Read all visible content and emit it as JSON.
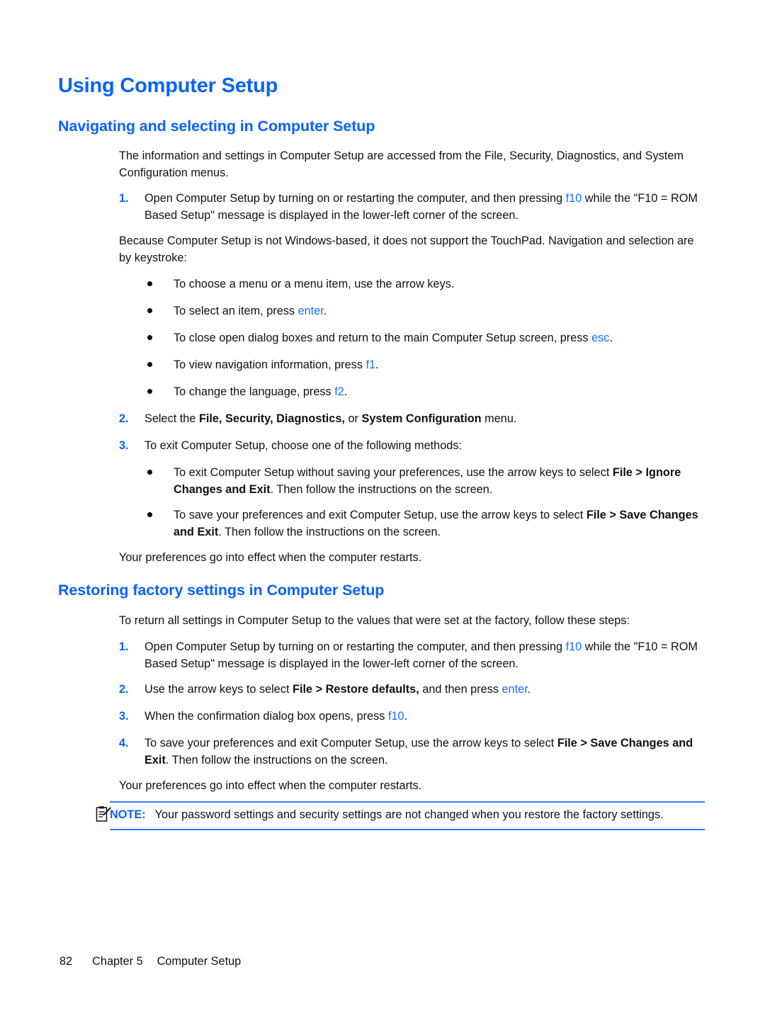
{
  "document": {
    "title": "Using Computer Setup"
  },
  "sections": {
    "navigating": {
      "heading": "Navigating and selecting in Computer Setup",
      "intro": "The information and settings in Computer Setup are accessed from the File, Security, Diagnostics, and System Configuration menus.",
      "step1": {
        "number": "1.",
        "text_a": "Open Computer Setup by turning on or restarting the computer, and then pressing ",
        "key": "f10",
        "text_b": " while the \"F10 = ROM Based Setup\" message is displayed in the lower-left corner of the screen."
      },
      "keystroke_intro": "Because Computer Setup is not Windows-based, it does not support the TouchPad. Navigation and selection are by keystroke:",
      "bullets": [
        {
          "text_a": "To choose a menu or a menu item, use the arrow keys.",
          "key": "",
          "text_b": ""
        },
        {
          "text_a": "To select an item, press ",
          "key": "enter",
          "text_b": "."
        },
        {
          "text_a": "To close open dialog boxes and return to the main Computer Setup screen, press ",
          "key": "esc",
          "text_b": "."
        },
        {
          "text_a": "To view navigation information, press ",
          "key": "f1",
          "text_b": "."
        },
        {
          "text_a": "To change the language, press ",
          "key": "f2",
          "text_b": "."
        }
      ],
      "step2": {
        "number": "2.",
        "text_a": "Select the ",
        "bold_a": "File, Security, Diagnostics,",
        "text_b": " or ",
        "bold_b": "System Configuration",
        "text_c": " menu."
      },
      "step3": {
        "number": "3.",
        "text": "To exit Computer Setup, choose one of the following methods:"
      },
      "exit_bullets": [
        {
          "text_a": "To exit Computer Setup without saving your preferences, use the arrow keys to select ",
          "bold": "File > Ignore Changes and Exit",
          "text_b": ". Then follow the instructions on the screen."
        },
        {
          "text_a": "To save your preferences and exit Computer Setup, use the arrow keys to select ",
          "bold": "File > Save Changes and Exit",
          "text_b": ". Then follow the instructions on the screen."
        }
      ],
      "closing": "Your preferences go into effect when the computer restarts."
    },
    "restoring": {
      "heading": "Restoring factory settings in Computer Setup",
      "intro": "To return all settings in Computer Setup to the values that were set at the factory, follow these steps:",
      "step1": {
        "number": "1.",
        "text_a": "Open Computer Setup by turning on or restarting the computer, and then pressing ",
        "key": "f10",
        "text_b": " while the \"F10 = ROM Based Setup\" message is displayed in the lower-left corner of the screen."
      },
      "step2": {
        "number": "2.",
        "text_a": "Use the arrow keys to select ",
        "bold": "File > Restore defaults,",
        "text_b": " and then press ",
        "key": "enter",
        "text_c": "."
      },
      "step3": {
        "number": "3.",
        "text_a": "When the confirmation dialog box opens, press ",
        "key": "f10",
        "text_b": "."
      },
      "step4": {
        "number": "4.",
        "text_a": "To save your preferences and exit Computer Setup, use the arrow keys to select ",
        "bold": "File > Save Changes and Exit",
        "text_b": ". Then follow the instructions on the screen."
      },
      "closing": "Your preferences go into effect when the computer restarts."
    }
  },
  "note": {
    "icon": "note-pencil-icon",
    "label": "NOTE:",
    "text": "Your password settings and security settings are not changed when you restore the factory settings."
  },
  "footer": {
    "page_number": "82",
    "chapter": "Chapter 5",
    "chapter_title": "Computer Setup"
  },
  "colors": {
    "heading_blue": "#0a63f5",
    "key_blue": "#1a6ef0",
    "note_rule": "#2f7cf6",
    "body_text": "#111111"
  }
}
